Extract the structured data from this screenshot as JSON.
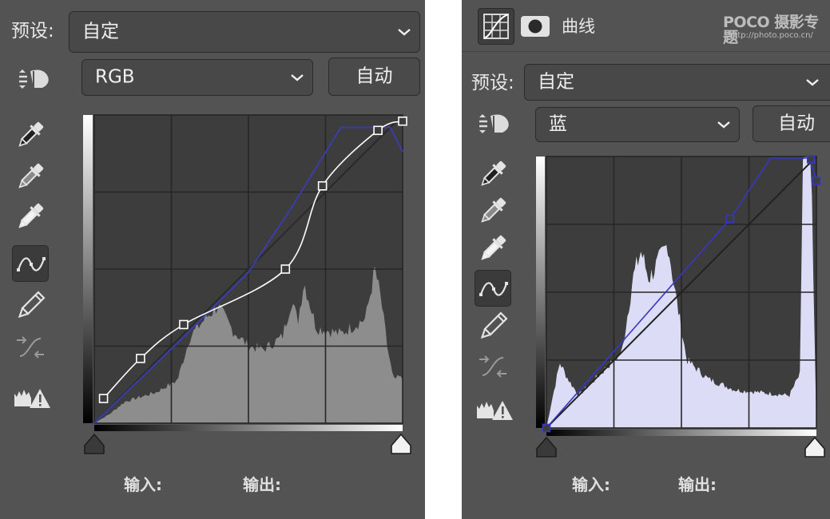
{
  "left": {
    "preset_label": "预设:",
    "preset_value": "自定",
    "channel_value": "RGB",
    "auto_label": "自动",
    "input_label": "输入:",
    "output_label": "输出:",
    "curve_color": "#ffffff",
    "histogram_color": "#8d8d8d",
    "reference_curve_color": "#3c3ca8",
    "curve_points": [
      [
        0.03,
        0.08
      ],
      [
        0.15,
        0.21
      ],
      [
        0.29,
        0.32
      ],
      [
        0.62,
        0.5
      ],
      [
        0.74,
        0.77
      ],
      [
        0.92,
        0.95
      ],
      [
        1.0,
        0.98
      ]
    ]
  },
  "right": {
    "header_title": "曲线",
    "watermark_brand": "POCO 摄影专题",
    "watermark_url": "http://photo.poco.cn/",
    "preset_label": "预设:",
    "preset_value": "自定",
    "channel_value": "蓝",
    "auto_label": "自动",
    "input_label": "输入:",
    "output_label": "输出:",
    "curve_color": "#3737c4",
    "histogram_color": "#dcdcf6",
    "curve_points": [
      [
        0.0,
        0.0
      ],
      [
        0.68,
        0.77
      ],
      [
        0.98,
        0.99
      ],
      [
        1.0,
        0.91
      ]
    ]
  },
  "icons": {
    "hand": "target-adjust-hand-icon",
    "black_eyedropper": "black-point-eyedropper-icon",
    "gray_eyedropper": "gray-point-eyedropper-icon",
    "white_eyedropper": "white-point-eyedropper-icon",
    "curve": "point-curve-icon",
    "pencil": "pencil-icon",
    "smooth": "smooth-curve-icon",
    "clip": "clipping-warning-icon"
  }
}
